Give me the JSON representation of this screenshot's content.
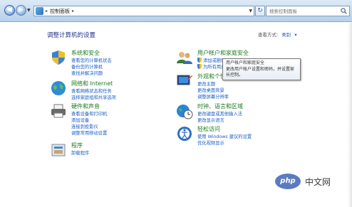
{
  "address_bar": {
    "crumb": "控制面板"
  },
  "search": {
    "placeholder": "搜索控制面板"
  },
  "header": {
    "title": "调整计算机的设置",
    "view_by_label": "查看方式:",
    "view_by_value": "类别"
  },
  "categories": [
    {
      "title": "系统和安全",
      "links": [
        "查看您的计算机状态",
        "备份您的计算机",
        "查找并解决问题"
      ]
    },
    {
      "title": "网络和 Internet",
      "links": [
        "查看网络状态和任务",
        "选择家庭组和共享选项"
      ]
    },
    {
      "title": "硬件和声音",
      "links": [
        "查看设备和打印机",
        "添加设备",
        "连接到投影仪",
        "调整常用移动设置"
      ]
    },
    {
      "title": "程序",
      "links": [
        "卸载程序"
      ]
    },
    {
      "title": "用户帐户和家庭安全",
      "links": [
        "添加或删除用户帐户",
        "为所有用户设置家长控制"
      ]
    },
    {
      "title": "外观和个性化",
      "links": [
        "更改主题",
        "更改桌面背景",
        "调整屏幕分辨率"
      ]
    },
    {
      "title": "时钟、语言和区域",
      "links": [
        "更改键盘或其他输入法",
        "更改显示语言"
      ]
    },
    {
      "title": "轻松访问",
      "links": [
        "使用 Windows 建议的设置",
        "优化视频显示"
      ]
    }
  ],
  "tooltip": {
    "line1": "用户帐户和家庭安全",
    "line2": "更改用户帐户设置和密码，并设置家",
    "line3": "长控制。"
  },
  "watermark": {
    "badge": "php",
    "text": "中文网"
  },
  "colors": {
    "category_title": "#1e7b21",
    "link": "#1a5ec5",
    "page_title": "#1e3287"
  }
}
